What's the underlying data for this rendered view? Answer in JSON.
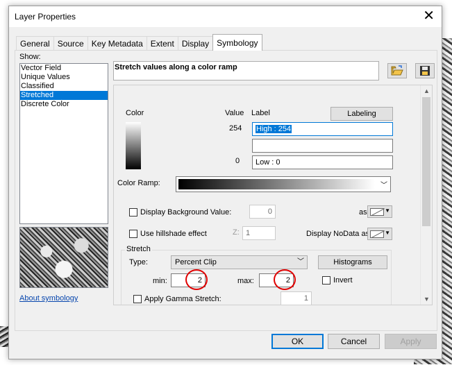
{
  "window": {
    "title": "Layer Properties",
    "close_glyph": "✕"
  },
  "tabs": [
    {
      "label": "General"
    },
    {
      "label": "Source"
    },
    {
      "label": "Key Metadata"
    },
    {
      "label": "Extent"
    },
    {
      "label": "Display"
    },
    {
      "label": "Symbology"
    }
  ],
  "active_tab": "Symbology",
  "show": {
    "label": "Show:",
    "items": [
      "Vector Field",
      "Unique Values",
      "Classified",
      "Stretched",
      "Discrete Color"
    ],
    "selected": "Stretched"
  },
  "about_link": "About symbology",
  "header": {
    "title": "Stretch values along a color ramp"
  },
  "icons": {
    "open_folder": "folder-open-icon",
    "save": "save-icon"
  },
  "table": {
    "color_header": "Color",
    "value_header": "Value",
    "label_header": "Label",
    "labeling_button": "Labeling",
    "high_value": "254",
    "high_label": "High : 254",
    "mid_label": "",
    "low_value": "0",
    "low_label": "Low : 0"
  },
  "color_ramp": {
    "label": "Color Ramp:"
  },
  "background": {
    "label": "Display Background Value:",
    "value": "0",
    "as_label": "as",
    "checked": false
  },
  "hillshade": {
    "label": "Use hillshade effect",
    "z_label": "Z:",
    "z_value": "1",
    "nodata_label": "Display NoData as",
    "checked": false
  },
  "stretch": {
    "group_label": "Stretch",
    "type_label": "Type:",
    "type_value": "Percent Clip",
    "histograms_button": "Histograms",
    "min_label": "min:",
    "min_value": "2",
    "max_label": "max:",
    "max_value": "2",
    "invert_label": "Invert",
    "invert_checked": false,
    "gamma_label": "Apply Gamma Stretch:",
    "gamma_value": "1",
    "gamma_checked": false
  },
  "footer": {
    "ok": "OK",
    "cancel": "Cancel",
    "apply": "Apply"
  },
  "colors": {
    "accent": "#0078d7",
    "annotation": "#e00000"
  }
}
